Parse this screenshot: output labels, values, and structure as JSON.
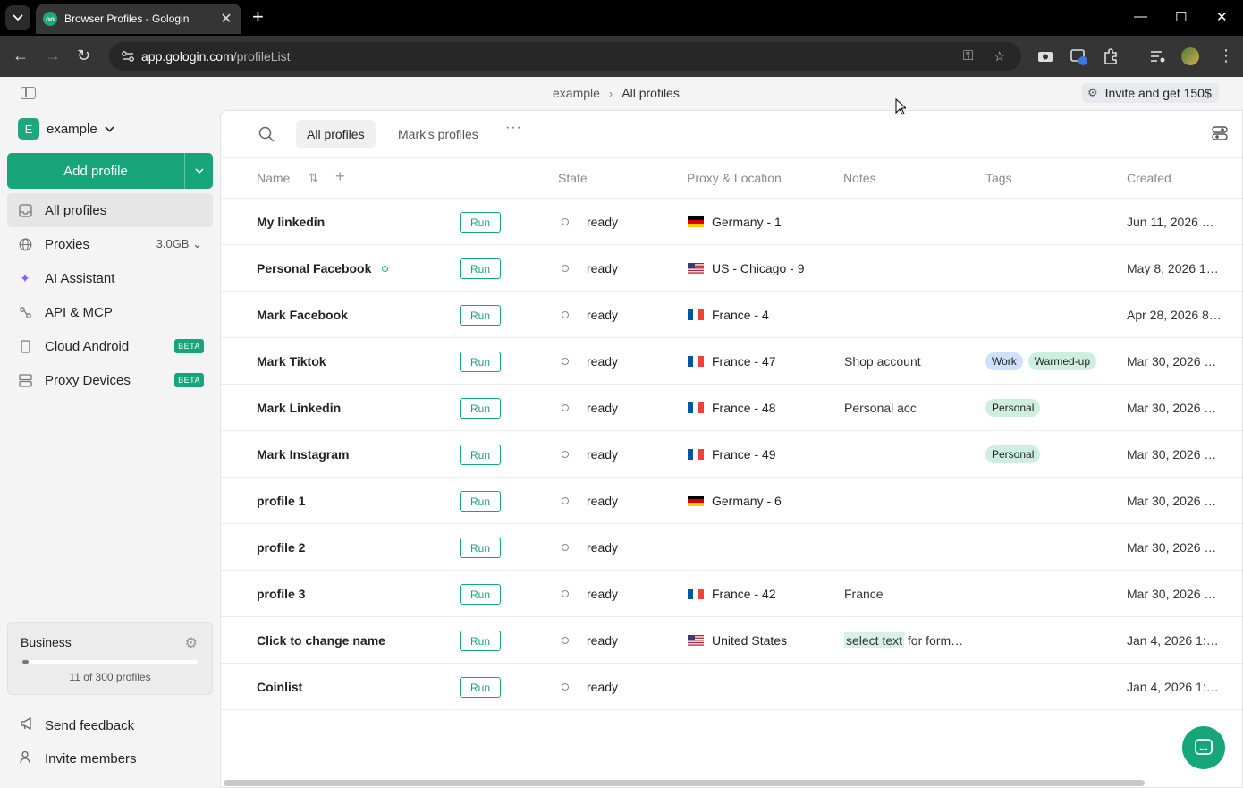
{
  "browser": {
    "tab_title": "Browser Profiles - Gologin",
    "url_domain": "app.gologin.com",
    "url_path": "/profileList"
  },
  "header": {
    "breadcrumb": [
      "example",
      "All profiles"
    ],
    "invite_label": "Invite and get 150$"
  },
  "sidebar": {
    "workspace_initial": "E",
    "workspace_name": "example",
    "add_profile_label": "Add profile",
    "items": [
      {
        "label": "All profiles",
        "icon": "inbox-icon"
      },
      {
        "label": "Proxies",
        "meta": "3.0GB",
        "icon": "globe-icon"
      },
      {
        "label": "AI Assistant",
        "icon": "sparkle-icon"
      },
      {
        "label": "API & MCP",
        "icon": "api-icon"
      },
      {
        "label": "Cloud Android",
        "badge": "BETA",
        "icon": "phone-icon"
      },
      {
        "label": "Proxy Devices",
        "badge": "BETA",
        "icon": "server-icon"
      }
    ],
    "plan": {
      "name": "Business",
      "usage_text": "11 of 300 profiles",
      "used": 11,
      "limit": 300
    },
    "send_feedback": "Send feedback",
    "invite_members": "Invite members"
  },
  "toolbar": {
    "folders": [
      "All profiles",
      "Mark's profiles"
    ],
    "more": "···"
  },
  "table": {
    "columns": {
      "name": "Name",
      "state": "State",
      "proxy": "Proxy & Location",
      "notes": "Notes",
      "tags": "Tags",
      "created": "Created"
    },
    "run_label": "Run",
    "rows": [
      {
        "name": "My linkedin",
        "state": "ready",
        "proxy": "Germany - 1",
        "flag": "de",
        "notes": "",
        "tags": [],
        "created": "Jun 11, 2026 …"
      },
      {
        "name": "Personal Facebook",
        "dot": true,
        "state": "ready",
        "proxy": "US - Chicago - 9",
        "flag": "us",
        "notes": "",
        "tags": [],
        "created": "May 8, 2026 1…"
      },
      {
        "name": "Mark Facebook",
        "state": "ready",
        "proxy": "France - 4",
        "flag": "fr",
        "notes": "",
        "tags": [],
        "created": "Apr 28, 2026 8…"
      },
      {
        "name": "Mark Tiktok",
        "state": "ready",
        "proxy": "France - 47",
        "flag": "fr",
        "notes": "Shop account",
        "tags": [
          {
            "label": "Work",
            "color": "#cfe0fb"
          },
          {
            "label": "Warmed-up",
            "color": "#cfeee2"
          }
        ],
        "created": "Mar 30, 2026 …"
      },
      {
        "name": "Mark Linkedin",
        "state": "ready",
        "proxy": "France - 48",
        "flag": "fr",
        "notes": "Personal acc",
        "tags": [
          {
            "label": "Personal",
            "color": "#cfeee2"
          }
        ],
        "created": "Mar 30, 2026 …"
      },
      {
        "name": "Mark Instagram",
        "state": "ready",
        "proxy": "France - 49",
        "flag": "fr",
        "notes": "",
        "tags": [
          {
            "label": "Personal",
            "color": "#cfeee2"
          }
        ],
        "created": "Mar 30, 2026 …"
      },
      {
        "name": "profile 1",
        "state": "ready",
        "proxy": "Germany - 6",
        "flag": "de",
        "notes": "",
        "tags": [],
        "created": "Mar 30, 2026 …"
      },
      {
        "name": "profile 2",
        "state": "ready",
        "proxy": "",
        "flag": "",
        "notes": "",
        "tags": [],
        "created": "Mar 30, 2026 …"
      },
      {
        "name": "profile 3",
        "state": "ready",
        "proxy": "France - 42",
        "flag": "fr",
        "notes": "France",
        "tags": [],
        "created": "Mar 30, 2026 …"
      },
      {
        "name": "Click to change name",
        "state": "ready",
        "proxy": "United States",
        "flag": "us",
        "notes_highlight": "select text",
        "notes": " for form…",
        "tags": [],
        "created": "Jan 4, 2026 1:…"
      },
      {
        "name": "Coinlist",
        "state": "ready",
        "proxy": "",
        "flag": "",
        "notes": "",
        "tags": [],
        "created": "Jan 4, 2026 1:…"
      }
    ]
  },
  "colors": {
    "accent": "#17a57a",
    "work_tag": "#cfe0fb",
    "green_tag": "#cfeee2"
  }
}
